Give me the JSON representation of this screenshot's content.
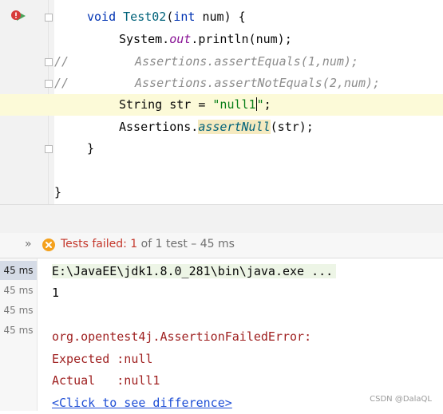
{
  "editor": {
    "method_signature": {
      "kw_void": "void",
      "name": "Test02",
      "paren_open": "(",
      "kw_int": "int",
      "param": " num) {"
    },
    "println": {
      "prefix": "System.",
      "field": "out",
      "suffix": ".println(num);"
    },
    "comment1": {
      "slashes": "//",
      "text": "Assertions.assertEquals(1,num);"
    },
    "comment2": {
      "slashes": "//",
      "text": "Assertions.assertNotEquals(2,num);"
    },
    "string_decl": {
      "prefix": "String str = ",
      "literal_a": "\"null1",
      "literal_b": "\"",
      "suffix": ";"
    },
    "assert_null": {
      "prefix": "Assertions.",
      "method": "assertNull",
      "suffix": "(str);"
    },
    "close_method": "}",
    "close_class": "}"
  },
  "test_header": {
    "expand_label": "»",
    "failed_label": "Tests failed:",
    "failed_count": "1",
    "summary": "of 1 test – 45 ms"
  },
  "timings": [
    "45 ms",
    "45 ms",
    "45 ms",
    "45 ms"
  ],
  "console": {
    "command": "E:\\JavaEE\\jdk1.8.0_281\\bin\\java.exe ...",
    "output": "1",
    "error": "org.opentest4j.AssertionFailedError:",
    "expected": "Expected :null",
    "actual": "Actual   :null1",
    "diff_link": "<Click to see difference>"
  },
  "watermark": "CSDN @DalaQL",
  "colors": {
    "keyword": "#0033b3",
    "string": "#067d17",
    "error": "#9e1e1e",
    "failed": "#c4372b",
    "link": "#1f4fd6"
  },
  "icons": [
    "run-error-gutter-icon",
    "fold-icon",
    "failed-x-icon",
    "chevron-double-right-icon"
  ]
}
